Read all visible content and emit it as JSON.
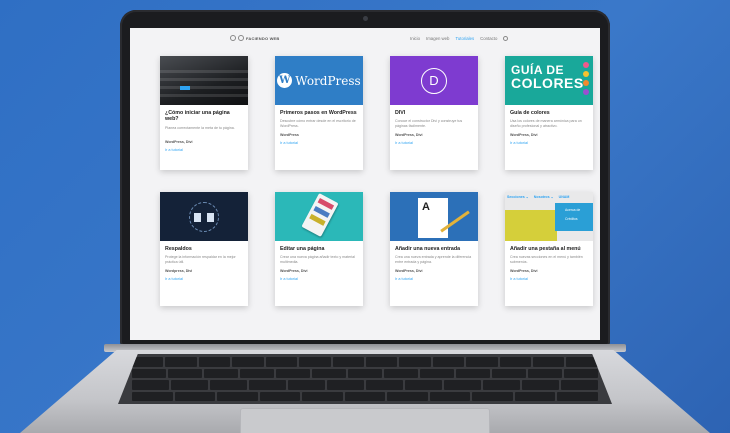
{
  "site": {
    "logo_text": "FACIENDO WEB",
    "nav": [
      "Inicio",
      "Imagen web",
      "Tutoriales",
      "Contacto"
    ],
    "active_nav": "Tutoriales"
  },
  "cards": [
    {
      "title": "¿Cómo iniciar una página web?",
      "desc": "Planea correctamente la meta de tu página.",
      "meta": "WordPress, Divi",
      "link": "Ir a tutorial"
    },
    {
      "title": "Primeros pasos en WordPress",
      "desc": "Descubre cómo entrar desde en el escritorio de WordPress.",
      "meta": "WordPress",
      "link": "Ir a tutorial",
      "thumb_text": "WordPress"
    },
    {
      "title": "DIVI",
      "desc": "Conoce el constructor Divi y construye tus páginas fácilmente.",
      "meta": "WordPress, Divi",
      "link": "Ir a tutorial",
      "thumb_text": "D"
    },
    {
      "title": "Guía de colores",
      "desc": "Usa los colores de manera armónica para un diseño profesional y atractivo.",
      "meta": "WordPress, Divi",
      "link": "Ir a tutorial",
      "thumb_text_1": "GUÍA DE",
      "thumb_text_2": "COLORES"
    },
    {
      "title": "Respaldos",
      "desc": "Protege la información respaldar en la mejor práctica útil.",
      "meta": "Wordpress, Divi",
      "link": "Ir a tutorial"
    },
    {
      "title": "Editar una página",
      "desc": "Crear una nueva página añadir texto y material multimedia.",
      "meta": "WordPress, Divi",
      "link": "Ir a tutorial"
    },
    {
      "title": "Añadir una nueva entrada",
      "desc": "Crea una nueva entrada y aprende la diferencia entre entrada y página.",
      "meta": "WordPress, Divi",
      "link": "Ir a tutorial",
      "thumb_text": "A"
    },
    {
      "title": "Añadir una pestaña al menú",
      "desc": "Crea nuevas secciones en el menú y también submenús.",
      "meta": "WordPress, Divi",
      "link": "Ir a tutorial",
      "menu_items": [
        "Secciones ⌄",
        "Nosotros ⌄",
        "UNAM"
      ],
      "dropdown_items": [
        "Acerca de",
        "Créditos"
      ]
    }
  ],
  "colors": {
    "background": "#2f6fc4",
    "accent": "#2ea3f2",
    "wordpress_blue": "#2f7ec6",
    "divi_purple": "#7e3bd0",
    "colores_teal": "#19a89a"
  }
}
